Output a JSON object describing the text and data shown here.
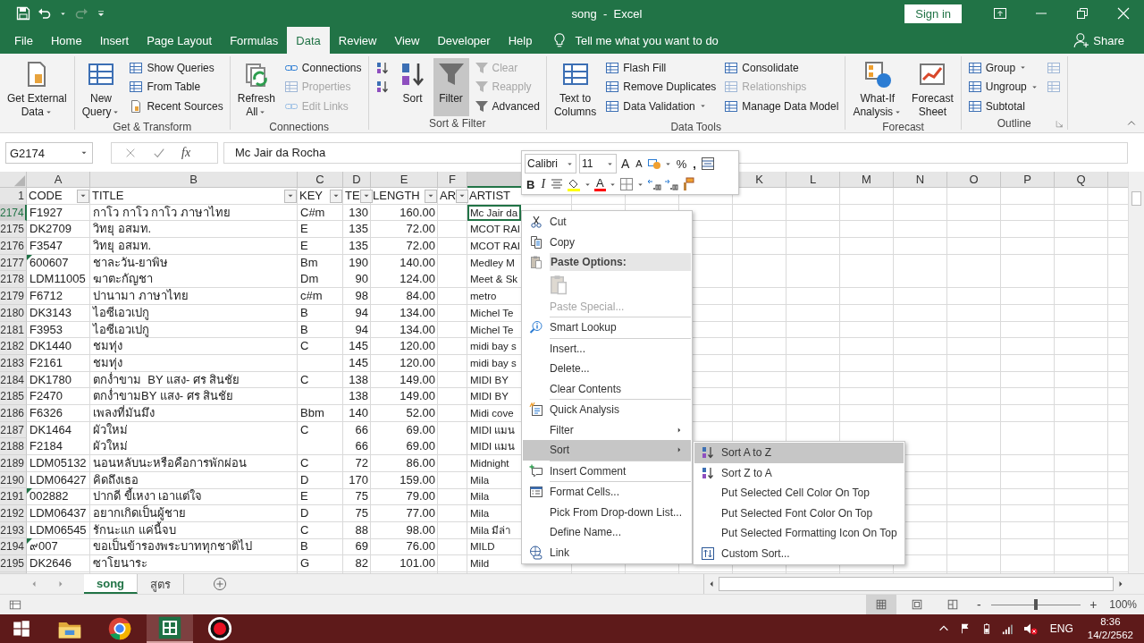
{
  "title_bar": {
    "title": "song  -  Excel",
    "sign_in": "Sign in"
  },
  "menu_tabs": [
    {
      "label": "File",
      "selected": false
    },
    {
      "label": "Home",
      "selected": false
    },
    {
      "label": "Insert",
      "selected": false
    },
    {
      "label": "Page Layout",
      "selected": false
    },
    {
      "label": "Formulas",
      "selected": false
    },
    {
      "label": "Data",
      "selected": true
    },
    {
      "label": "Review",
      "selected": false
    },
    {
      "label": "View",
      "selected": false
    },
    {
      "label": "Developer",
      "selected": false
    },
    {
      "label": "Help",
      "selected": false
    }
  ],
  "tell_me": {
    "placeholder": "Tell me what you want to do"
  },
  "share": "Share",
  "ribbon": {
    "groups": [
      {
        "columns": [
          {
            "kind": "large",
            "label": "Get External\nData",
            "dropdown": true,
            "disabled": false,
            "pressed": false
          }
        ]
      },
      {
        "label": "Get & Transform",
        "launcher": false,
        "columns": [
          {
            "kind": "large",
            "label": "New\nQuery",
            "dropdown": true,
            "disabled": false,
            "pressed": false
          },
          {
            "kind": "stack",
            "items": [
              {
                "label": "Show Queries",
                "dropdown": false,
                "disabled": false
              },
              {
                "label": "From Table",
                "dropdown": false,
                "disabled": false
              },
              {
                "label": "Recent Sources",
                "dropdown": false,
                "disabled": false
              }
            ]
          }
        ]
      },
      {
        "label": "Connections",
        "launcher": false,
        "columns": [
          {
            "kind": "large",
            "label": "Refresh\nAll",
            "dropdown": true,
            "disabled": false,
            "pressed": false
          },
          {
            "kind": "stack",
            "items": [
              {
                "label": "Connections",
                "dropdown": false,
                "disabled": false
              },
              {
                "label": "Properties",
                "dropdown": false,
                "disabled": true
              },
              {
                "label": "Edit Links",
                "dropdown": false,
                "disabled": true
              }
            ]
          }
        ]
      },
      {
        "label": "Sort & Filter",
        "launcher": false,
        "columns": [
          {
            "kind": "stack",
            "items": [
              {
                "dropdown": false,
                "disabled": false
              },
              {
                "dropdown": false,
                "disabled": false
              }
            ]
          },
          {
            "kind": "large",
            "label": "Sort",
            "dropdown": false,
            "disabled": false,
            "pressed": false
          },
          {
            "kind": "large",
            "label": "Filter",
            "dropdown": false,
            "disabled": false,
            "pressed": true
          },
          {
            "kind": "stack",
            "items": [
              {
                "label": "Clear",
                "dropdown": false,
                "disabled": true
              },
              {
                "label": "Reapply",
                "dropdown": false,
                "disabled": true
              },
              {
                "label": "Advanced",
                "dropdown": false,
                "disabled": false
              }
            ]
          }
        ]
      },
      {
        "label": "Data Tools",
        "launcher": false,
        "columns": [
          {
            "kind": "large",
            "label": "Text to\nColumns",
            "dropdown": false,
            "disabled": false,
            "pressed": false
          },
          {
            "kind": "stack",
            "items": [
              {
                "label": "Flash Fill",
                "dropdown": false,
                "disabled": false
              },
              {
                "label": "Remove Duplicates",
                "dropdown": false,
                "disabled": false
              },
              {
                "label": "Data Validation",
                "dropdown": true,
                "disabled": false
              }
            ]
          },
          {
            "kind": "stack",
            "items": [
              {
                "label": "Consolidate",
                "dropdown": false,
                "disabled": false
              },
              {
                "label": "Relationships",
                "dropdown": false,
                "disabled": true
              },
              {
                "label": "Manage Data Model",
                "dropdown": false,
                "disabled": false
              }
            ]
          }
        ]
      },
      {
        "label": "Forecast",
        "launcher": false,
        "columns": [
          {
            "kind": "large",
            "label": "What-If\nAnalysis",
            "dropdown": true,
            "disabled": false,
            "pressed": false
          },
          {
            "kind": "large",
            "label": "Forecast\nSheet",
            "dropdown": false,
            "disabled": false,
            "pressed": false
          }
        ]
      },
      {
        "label": "Outline",
        "launcher": true,
        "columns": [
          {
            "kind": "stack",
            "items": [
              {
                "label": "Group",
                "dropdown": true,
                "disabled": false
              },
              {
                "label": "Ungroup",
                "dropdown": true,
                "disabled": false
              },
              {
                "label": "Subtotal",
                "dropdown": false,
                "disabled": false
              }
            ]
          },
          {
            "kind": "stack",
            "items": [
              {
                "dropdown": false,
                "disabled": true
              },
              {
                "dropdown": false,
                "disabled": true
              }
            ]
          }
        ]
      }
    ]
  },
  "formula_bar": {
    "name_box": "G2174",
    "function_label": "fx",
    "value": "Mc Jair da Rocha"
  },
  "sheet": {
    "columns": [
      {
        "letter": "A",
        "selected": false
      },
      {
        "letter": "B",
        "selected": false
      },
      {
        "letter": "C",
        "selected": false
      },
      {
        "letter": "D",
        "selected": false
      },
      {
        "letter": "E",
        "selected": false
      },
      {
        "letter": "F",
        "selected": false
      },
      {
        "selected": true
      },
      {
        "letter": "K",
        "selected": false
      },
      {
        "letter": "L",
        "selected": false
      },
      {
        "letter": "M",
        "selected": false
      },
      {
        "letter": "N",
        "selected": false
      },
      {
        "letter": "O",
        "selected": false
      },
      {
        "letter": "P",
        "selected": false
      },
      {
        "letter": "Q",
        "selected": false
      }
    ],
    "header_row": {
      "number": "1",
      "cells": [
        {
          "text": "CODE",
          "filter": true
        },
        {
          "text": "TITLE",
          "filter": true
        },
        {
          "text": "KEY",
          "filter": true
        },
        {
          "text": "TE",
          "filter": true
        },
        {
          "text": "LENGTH",
          "filter": true
        },
        {
          "text": "AR",
          "filter": true
        },
        {
          "text": "ARTIST"
        }
      ]
    },
    "rows": [
      {
        "number": "2174",
        "selected": true,
        "code": "F1927",
        "error_mark": false,
        "title": "กาโว กาโว กาโว ภาษาไทย",
        "key": "C#m",
        "tempo": "130",
        "length": "160.00",
        "artist": "Mc Jair da",
        "active": true
      },
      {
        "number": "2175",
        "selected": false,
        "code": "DK2709",
        "error_mark": false,
        "title": "วิทยุ อสมท.",
        "key": "E",
        "tempo": "135",
        "length": "72.00",
        "artist": "MCOT RAI",
        "active": false
      },
      {
        "number": "2176",
        "selected": false,
        "code": "F3547",
        "error_mark": false,
        "title": "วิทยุ อสมท.",
        "key": "E",
        "tempo": "135",
        "length": "72.00",
        "artist": "MCOT RAI",
        "active": false
      },
      {
        "number": "2177",
        "selected": false,
        "code": "600607",
        "error_mark": true,
        "title": "ชาละวัน-ยาพิษ",
        "key": "Bm",
        "tempo": "190",
        "length": "140.00",
        "artist": "Medley M",
        "active": false
      },
      {
        "number": "2178",
        "selected": false,
        "code": "LDM11005",
        "error_mark": false,
        "title": "ฆาตะกัญชา",
        "key": "Dm",
        "tempo": "90",
        "length": "124.00",
        "artist": "Meet & Sk",
        "active": false
      },
      {
        "number": "2179",
        "selected": false,
        "code": "F6712",
        "error_mark": false,
        "title": "ปานามา ภาษาไทย",
        "key": "c#m",
        "tempo": "98",
        "length": "84.00",
        "artist": "metro",
        "active": false
      },
      {
        "number": "2180",
        "selected": false,
        "code": "DK3143",
        "error_mark": false,
        "title": "ไอซีเอวเปกู",
        "key": "B",
        "tempo": "94",
        "length": "134.00",
        "artist": "Michel Te",
        "active": false
      },
      {
        "number": "2181",
        "selected": false,
        "code": "F3953",
        "error_mark": false,
        "title": "ไอซีเอวเปกู",
        "key": "B",
        "tempo": "94",
        "length": "134.00",
        "artist": "Michel Te",
        "active": false
      },
      {
        "number": "2182",
        "selected": false,
        "code": "DK1440",
        "error_mark": false,
        "title": "ชมทุ่ง",
        "key": "C",
        "tempo": "145",
        "length": "120.00",
        "artist": "midi bay s",
        "active": false
      },
      {
        "number": "2183",
        "selected": false,
        "code": "F2161",
        "error_mark": false,
        "title": "ชมทุ่ง",
        "tempo": "145",
        "length": "120.00",
        "artist": "midi bay s",
        "active": false
      },
      {
        "number": "2184",
        "selected": false,
        "code": "DK1780",
        "error_mark": false,
        "title": "ตกง่ำขาม  BY แสง- ศร สินชัย",
        "key": "C",
        "tempo": "138",
        "length": "149.00",
        "artist": "MIDI BY",
        "active": false
      },
      {
        "number": "2185",
        "selected": false,
        "code": "F2470",
        "error_mark": false,
        "title": "ตกง่ำขามBY แสง- ศร สินชัย",
        "tempo": "138",
        "length": "149.00",
        "artist": "MIDI BY",
        "active": false
      },
      {
        "number": "2186",
        "selected": false,
        "code": "F6326",
        "error_mark": false,
        "title": "เพลงที่มันมึง",
        "key": "Bbm",
        "tempo": "140",
        "length": "52.00",
        "artist": "Midi cove",
        "active": false
      },
      {
        "number": "2187",
        "selected": false,
        "code": "DK1464",
        "error_mark": false,
        "title": "ผัวใหม่",
        "key": "C",
        "tempo": "66",
        "length": "69.00",
        "artist": "MIDI แมน",
        "active": false
      },
      {
        "number": "2188",
        "selected": false,
        "code": "F2184",
        "error_mark": false,
        "title": "ผัวใหม่",
        "tempo": "66",
        "length": "69.00",
        "artist": "MIDI แมน",
        "active": false
      },
      {
        "number": "2189",
        "selected": false,
        "code": "LDM05132",
        "error_mark": false,
        "title": "นอนหลับนะหรือคือการพักผ่อน",
        "key": "C",
        "tempo": "72",
        "length": "86.00",
        "artist": "Midnight",
        "active": false
      },
      {
        "number": "2190",
        "selected": false,
        "code": "LDM06427",
        "error_mark": false,
        "title": "คิดถึงเธอ",
        "key": "D",
        "tempo": "170",
        "length": "159.00",
        "artist": "Mila",
        "active": false
      },
      {
        "number": "2191",
        "selected": false,
        "code": "002882",
        "error_mark": true,
        "title": "ปากดี ขี้เหงา เอาแต่ใจ",
        "key": "E",
        "tempo": "75",
        "length": "79.00",
        "artist": "Mila",
        "active": false
      },
      {
        "number": "2192",
        "selected": false,
        "code": "LDM06437",
        "error_mark": false,
        "title": "อยากเกิดเป็นผู้ชาย",
        "key": "D",
        "tempo": "75",
        "length": "77.00",
        "artist": "Mila",
        "active": false
      },
      {
        "number": "2193",
        "selected": false,
        "code": "LDM06545",
        "error_mark": false,
        "title": "รักนะแก แค่นี้จบ",
        "key": "C",
        "tempo": "88",
        "length": "98.00",
        "artist": "Mila มีล่า",
        "active": false
      },
      {
        "number": "2194",
        "selected": false,
        "code": "๙007",
        "error_mark": true,
        "title": "ขอเป็นข้ารองพระบาททุกชาติไป",
        "key": "B",
        "tempo": "69",
        "length": "76.00",
        "artist": "MILD",
        "active": false
      },
      {
        "number": "2195",
        "selected": false,
        "code": "DK2646",
        "error_mark": false,
        "title": "ซาโยนาระ",
        "key": "G",
        "tempo": "82",
        "length": "101.00",
        "artist": "Mild",
        "active": false
      }
    ]
  },
  "mini_toolbar": {
    "font": "Calibri",
    "size": "11",
    "grow": "A",
    "shrink": "A",
    "percent": "%",
    "comma": ",",
    "bold": "B",
    "italic": "I",
    "font_color": "A"
  },
  "context_menu": {
    "items": [
      {
        "kind": "item",
        "label": "Cut",
        "disabled": false,
        "selected": false,
        "submenu": false
      },
      {
        "kind": "item",
        "label": "Copy",
        "disabled": false,
        "selected": false,
        "submenu": false
      },
      {
        "kind": "header",
        "label": "Paste Options:"
      },
      {
        "kind": "paste_icons"
      },
      {
        "kind": "item",
        "label": "Paste Special...",
        "disabled": true,
        "selected": false,
        "submenu": false
      },
      {
        "kind": "separator"
      },
      {
        "kind": "item",
        "label": "Smart Lookup",
        "disabled": false,
        "selected": false,
        "submenu": false
      },
      {
        "kind": "separator"
      },
      {
        "kind": "item",
        "label": "Insert...",
        "disabled": false,
        "selected": false,
        "submenu": false
      },
      {
        "kind": "item",
        "label": "Delete...",
        "disabled": false,
        "selected": false,
        "submenu": false
      },
      {
        "kind": "item",
        "label": "Clear Contents",
        "disabled": false,
        "selected": false,
        "submenu": false
      },
      {
        "kind": "separator"
      },
      {
        "kind": "item",
        "label": "Quick Analysis",
        "disabled": false,
        "selected": false,
        "submenu": false
      },
      {
        "kind": "item",
        "label": "Filter",
        "disabled": false,
        "selected": false,
        "submenu": true
      },
      {
        "kind": "item",
        "label": "Sort",
        "disabled": false,
        "selected": true,
        "submenu": true
      },
      {
        "kind": "separator"
      },
      {
        "kind": "item",
        "label": "Insert Comment",
        "disabled": false,
        "selected": false,
        "submenu": false
      },
      {
        "kind": "separator"
      },
      {
        "kind": "item",
        "label": "Format Cells...",
        "disabled": false,
        "selected": false,
        "submenu": false
      },
      {
        "kind": "item",
        "label": "Pick From Drop-down List...",
        "disabled": false,
        "selected": false,
        "submenu": false
      },
      {
        "kind": "item",
        "label": "Define Name...",
        "disabled": false,
        "selected": false,
        "submenu": false
      },
      {
        "kind": "item",
        "label": "Link",
        "disabled": false,
        "selected": false,
        "submenu": false
      }
    ]
  },
  "sort_submenu": {
    "items": [
      {
        "label": "Sort A to Z",
        "selected": true
      },
      {
        "label": "Sort Z to A",
        "selected": false
      },
      {
        "label": "Put Selected Cell Color On Top",
        "selected": false
      },
      {
        "label": "Put Selected Font Color On Top",
        "selected": false
      },
      {
        "label": "Put Selected Formatting Icon On Top",
        "selected": false
      },
      {
        "label": "Custom Sort...",
        "selected": false
      }
    ]
  },
  "sheet_tabs": [
    {
      "label": "song",
      "selected": true
    },
    {
      "label": "สูตร",
      "selected": false
    }
  ],
  "status_bar": {
    "views": [
      {
        "selected": true
      },
      {
        "selected": false
      },
      {
        "selected": false
      }
    ],
    "zoom_out": "-",
    "zoom_slider": {
      "level": 0.5
    },
    "zoom_in": "+",
    "zoom": "100%"
  },
  "taskbar": {
    "apps": [
      {
        "selected": false
      },
      {
        "selected": false
      },
      {
        "selected": true
      },
      {
        "selected": false
      }
    ],
    "language": "ENG",
    "time": "8:36",
    "date": "14/2/2562"
  }
}
